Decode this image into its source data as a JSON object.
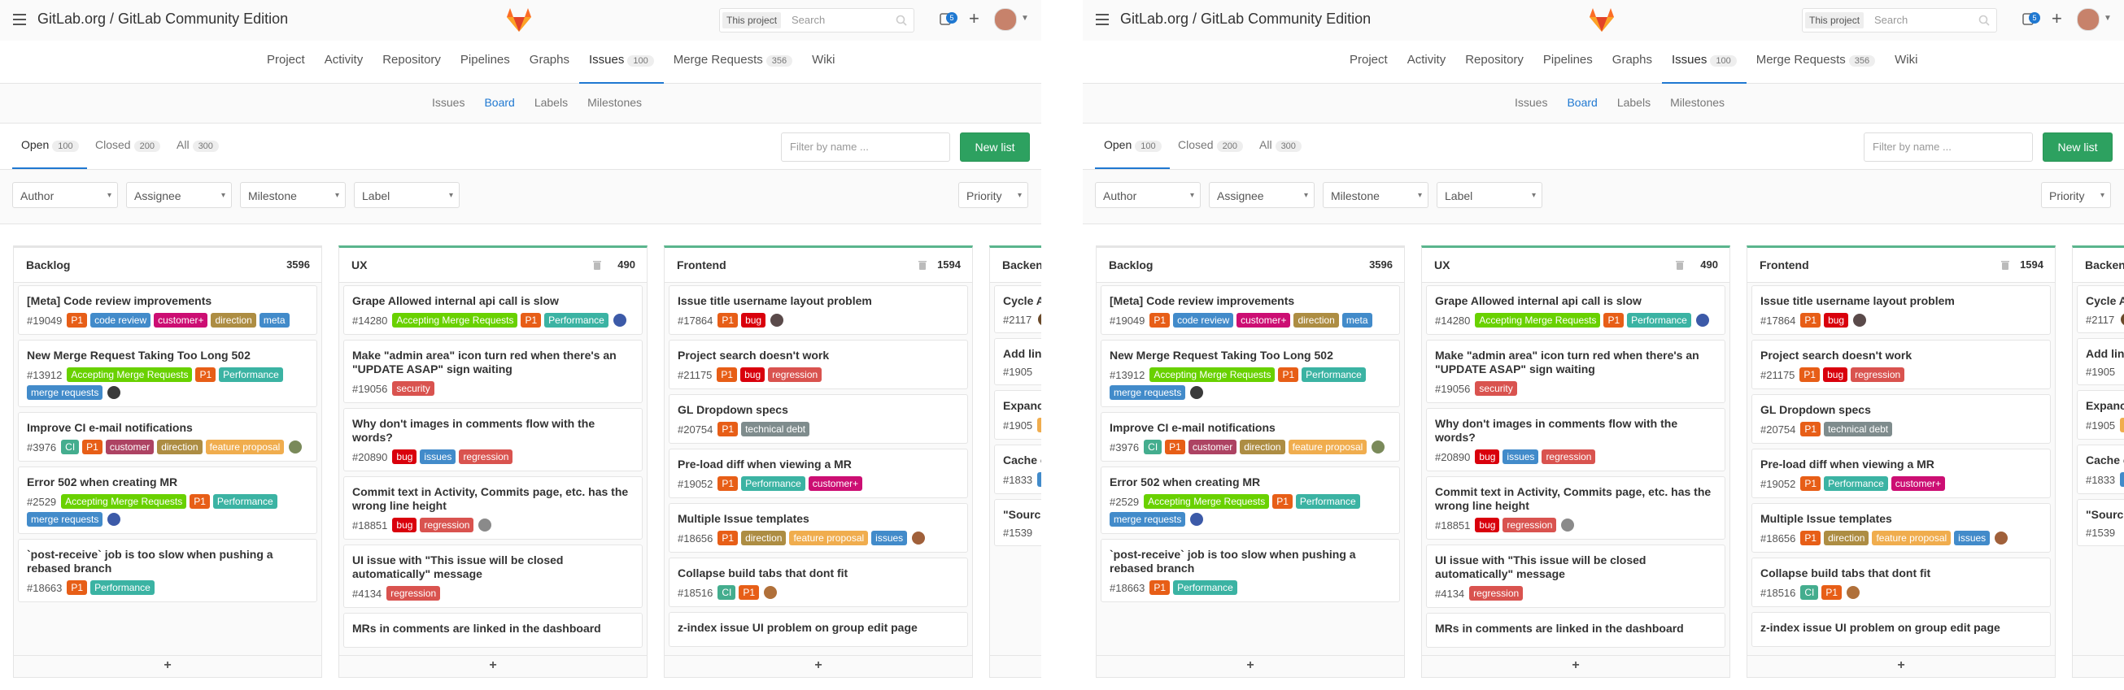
{
  "header": {
    "title": "GitLab.org / GitLab Community Edition",
    "search_scope": "This project",
    "search_placeholder": "Search",
    "todo_count": "5"
  },
  "nav": {
    "items": [
      {
        "label": "Project"
      },
      {
        "label": "Activity"
      },
      {
        "label": "Repository"
      },
      {
        "label": "Pipelines"
      },
      {
        "label": "Graphs"
      },
      {
        "label": "Issues",
        "count": "100",
        "active": true
      },
      {
        "label": "Merge Requests",
        "count": "356"
      },
      {
        "label": "Wiki"
      }
    ]
  },
  "subnav": {
    "items": [
      {
        "label": "Issues"
      },
      {
        "label": "Board",
        "active": true
      },
      {
        "label": "Labels"
      },
      {
        "label": "Milestones"
      }
    ]
  },
  "tabs": {
    "open": {
      "label": "Open",
      "count": "100"
    },
    "closed": {
      "label": "Closed",
      "count": "200"
    },
    "all": {
      "label": "All",
      "count": "300"
    },
    "filter_placeholder": "Filter by name ...",
    "new_list": "New list"
  },
  "filters": {
    "author": "Author",
    "assignee": "Assignee",
    "milestone": "Milestone",
    "label": "Label",
    "sort": "Priority"
  },
  "colors": {
    "accent": "#1f78d1",
    "new_list_green": "#2da160",
    "list_top_green": "#5ab58d"
  },
  "label_colors": {
    "P1": "#e75e17",
    "code review": "#428bca",
    "customer+": "#cc0e73",
    "direction": "#ad8d43",
    "meta": "#428bca",
    "Accepting Merge Requests": "#69d100",
    "Performance": "#3bb3a3",
    "merge requests": "#428bca",
    "CI": "#44ad8e",
    "customer": "#ad4363",
    "feature proposal": "#f0ad4e",
    "security": "#d9534f",
    "bug": "#d9000c",
    "regression": "#d9534f",
    "issues": "#428bca",
    "technical debt": "#7f8c8d"
  },
  "lists": [
    {
      "title": "Backlog",
      "count": "3596",
      "highlight": false,
      "cards": [
        {
          "title": "[Meta] Code review improvements",
          "iid": "#19049",
          "labels": [
            "P1",
            "code review",
            "customer+",
            "direction",
            "meta"
          ],
          "avatar": ""
        },
        {
          "title": "New Merge Request Taking Too Long 502",
          "iid": "#13912",
          "labels": [
            "Accepting Merge Requests",
            "P1",
            "Performance",
            "merge requests"
          ],
          "avatar": "#3a3a3a"
        },
        {
          "title": "Improve CI e-mail notifications",
          "iid": "#3976",
          "labels": [
            "CI",
            "P1",
            "customer",
            "direction",
            "feature proposal"
          ],
          "avatar": "#7a8a5a"
        },
        {
          "title": "Error 502 when creating MR",
          "iid": "#2529",
          "labels": [
            "Accepting Merge Requests",
            "P1",
            "Performance",
            "merge requests"
          ],
          "avatar": "#3c5aa8"
        },
        {
          "title": "`post-receive` job is too slow when pushing a rebased branch",
          "iid": "#18663",
          "labels": [
            "P1",
            "Performance"
          ],
          "avatar": ""
        }
      ]
    },
    {
      "title": "UX",
      "count": "490",
      "highlight": true,
      "cards": [
        {
          "title": "Grape Allowed internal api call is slow",
          "iid": "#14280",
          "labels": [
            "Accepting Merge Requests",
            "P1",
            "Performance"
          ],
          "avatar": "#3c5aa8"
        },
        {
          "title": "Make \"admin area\" icon turn red when there's an \"UPDATE ASAP\" sign waiting",
          "iid": "#19056",
          "labels": [
            "security"
          ],
          "avatar": ""
        },
        {
          "title": "Why don't images in comments flow with the words?",
          "iid": "#20890",
          "labels": [
            "bug",
            "issues",
            "regression"
          ],
          "avatar": ""
        },
        {
          "title": "Commit text in Activity, Commits page, etc. has the wrong line height",
          "iid": "#18851",
          "labels": [
            "bug",
            "regression"
          ],
          "avatar": "#8a8a8a"
        },
        {
          "title": "UI issue with \"This issue will be closed automatically\" message",
          "iid": "#4134",
          "labels": [
            "regression"
          ],
          "avatar": ""
        },
        {
          "title": "MRs in comments are linked in the dashboard",
          "iid": "",
          "labels": [],
          "avatar": ""
        }
      ]
    },
    {
      "title": "Frontend",
      "count": "1594",
      "highlight": true,
      "cards": [
        {
          "title": "Issue title username layout problem",
          "iid": "#17864",
          "labels": [
            "P1",
            "bug"
          ],
          "avatar": "#5a4a4a"
        },
        {
          "title": "Project search doesn't work",
          "iid": "#21175",
          "labels": [
            "P1",
            "bug",
            "regression"
          ],
          "avatar": ""
        },
        {
          "title": "GL Dropdown specs",
          "iid": "#20754",
          "labels": [
            "P1",
            "technical debt"
          ],
          "avatar": ""
        },
        {
          "title": "Pre-load diff when viewing a MR",
          "iid": "#19052",
          "labels": [
            "P1",
            "Performance",
            "customer+"
          ],
          "avatar": ""
        },
        {
          "title": "Multiple Issue templates",
          "iid": "#18656",
          "labels": [
            "P1",
            "direction",
            "feature proposal",
            "issues"
          ],
          "avatar": "#a0603a"
        },
        {
          "title": "Collapse build tabs that dont fit",
          "iid": "#18516",
          "labels": [
            "CI",
            "P1"
          ],
          "avatar": "#b0703a"
        },
        {
          "title": "z-index issue UI problem on group edit page",
          "iid": "",
          "labels": [],
          "avatar": ""
        }
      ]
    },
    {
      "title": "Backen",
      "count": "",
      "highlight": true,
      "cards": [
        {
          "title": "Cycle A",
          "iid": "#2117",
          "labels": [],
          "avatar": "#6a4a2a"
        },
        {
          "title": "Add lin",
          "iid": "#1905",
          "labels": [],
          "avatar": ""
        },
        {
          "title": "Expanc",
          "iid": "#1905",
          "labels": [
            "feature proposal"
          ],
          "avatar": ""
        },
        {
          "title": "Cache of in R",
          "iid": "#1833",
          "labels": [
            "merge requests"
          ],
          "avatar": ""
        },
        {
          "title": "\"Sourc not exi",
          "iid": "#1539",
          "labels": [],
          "avatar": ""
        }
      ]
    }
  ]
}
